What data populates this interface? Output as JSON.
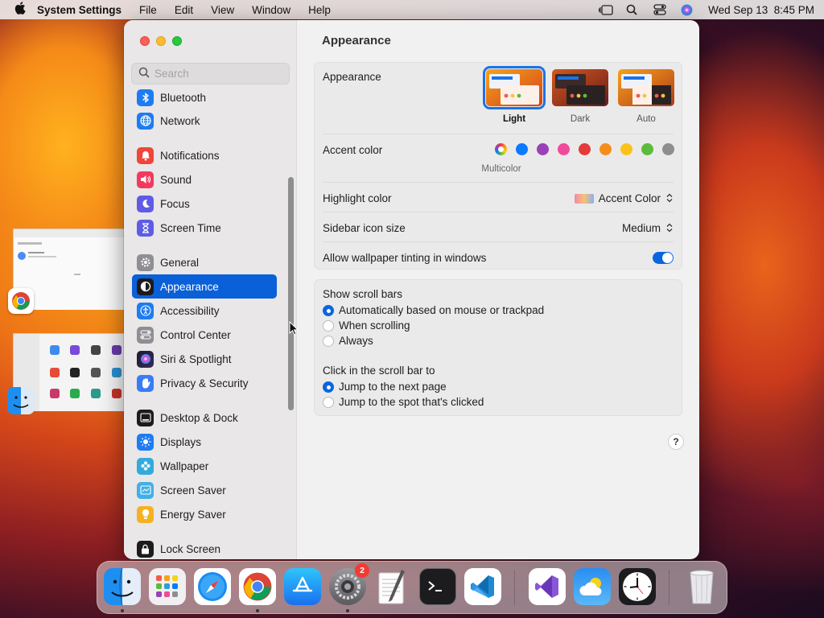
{
  "menubar": {
    "app_name": "System Settings",
    "menus": [
      "File",
      "Edit",
      "View",
      "Window",
      "Help"
    ],
    "clock": "Wed Sep 13  8:45 PM"
  },
  "sidebar": {
    "search_placeholder": "Search",
    "items": [
      {
        "label": "Bluetooth",
        "icon": "bluetooth-icon",
        "color": "#1d7cf2"
      },
      {
        "label": "Network",
        "icon": "globe-icon",
        "color": "#1d7cf2"
      },
      {
        "label": "Notifications",
        "icon": "bell-icon",
        "color": "#f0453a"
      },
      {
        "label": "Sound",
        "icon": "speaker-icon",
        "color": "#f23a5d"
      },
      {
        "label": "Focus",
        "icon": "moon-icon",
        "color": "#5e5ce6"
      },
      {
        "label": "Screen Time",
        "icon": "hourglass-icon",
        "color": "#5e5ce6"
      },
      {
        "label": "General",
        "icon": "gear-icon",
        "color": "#8e8e93"
      },
      {
        "label": "Appearance",
        "icon": "appearance-icon",
        "color": "#1c1c1e"
      },
      {
        "label": "Accessibility",
        "icon": "accessibility-icon",
        "color": "#1d7cf2"
      },
      {
        "label": "Control Center",
        "icon": "control-center-icon",
        "color": "#8e8e93"
      },
      {
        "label": "Siri & Spotlight",
        "icon": "siri-icon",
        "color": "#b34ad8"
      },
      {
        "label": "Privacy & Security",
        "icon": "hand-icon",
        "color": "#3a7cf6"
      },
      {
        "label": "Desktop & Dock",
        "icon": "dock-icon",
        "color": "#1c1c1e"
      },
      {
        "label": "Displays",
        "icon": "sun-icon",
        "color": "#1d7cf2"
      },
      {
        "label": "Wallpaper",
        "icon": "flower-icon",
        "color": "#33aadd"
      },
      {
        "label": "Screen Saver",
        "icon": "screen-saver-icon",
        "color": "#41b0e8"
      },
      {
        "label": "Energy Saver",
        "icon": "battery-icon",
        "color": "#f5b120"
      },
      {
        "label": "Lock Screen",
        "icon": "lock-icon",
        "color": "#1c1c1e"
      }
    ],
    "selected": "Appearance"
  },
  "main": {
    "title": "Appearance",
    "appearance": {
      "label": "Appearance",
      "options": [
        "Light",
        "Dark",
        "Auto"
      ],
      "selected": "Light"
    },
    "accent": {
      "label": "Accent color",
      "selected_name": "Multicolor",
      "colors": [
        "#0a7aff",
        "#9a40b8",
        "#f04a9a",
        "#e43a3a",
        "#f58d1d",
        "#fbc21b",
        "#5cbb3c",
        "#8e8e8e"
      ]
    },
    "highlight": {
      "label": "Highlight color",
      "value": "Accent Color"
    },
    "icon_size": {
      "label": "Sidebar icon size",
      "value": "Medium"
    },
    "tinting": {
      "label": "Allow wallpaper tinting in windows",
      "enabled": true
    },
    "scroll_bars": {
      "label": "Show scroll bars",
      "options": [
        "Automatically based on mouse or trackpad",
        "When scrolling",
        "Always"
      ],
      "selected": 0
    },
    "click_scroll": {
      "label": "Click in the scroll bar to",
      "options": [
        "Jump to the next page",
        "Jump to the spot that's clicked"
      ],
      "selected": 0
    },
    "help": "?"
  },
  "dock": {
    "settings_badge": "2"
  }
}
